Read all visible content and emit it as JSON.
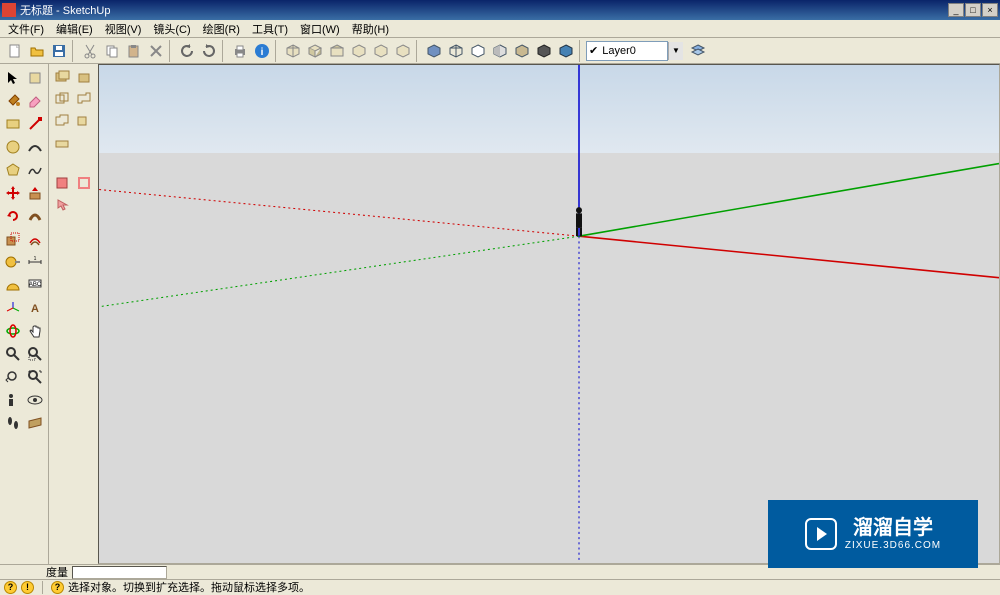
{
  "window": {
    "title": "无标题 - SketchUp",
    "min": "_",
    "max": "□",
    "close": "×"
  },
  "menus": [
    "文件(F)",
    "编辑(E)",
    "视图(V)",
    "镜头(C)",
    "绘图(R)",
    "工具(T)",
    "窗口(W)",
    "帮助(H)"
  ],
  "layer": {
    "current": "Layer0",
    "checked": "✔"
  },
  "status": {
    "measure_label": "度量",
    "measure_value": ""
  },
  "help": {
    "tip": "选择对象。切换到扩充选择。拖动鼠标选择多项。"
  },
  "watermark": {
    "brand": "溜溜自学",
    "url": "ZIXUE.3D66.COM"
  },
  "colors": {
    "titlebar_start": "#0a246a",
    "titlebar_end": "#3a6ea5",
    "bg": "#ece9d8",
    "axis_x": "#d00000",
    "axis_y": "#00a000",
    "axis_z": "#0000d0"
  },
  "chart_data": null
}
